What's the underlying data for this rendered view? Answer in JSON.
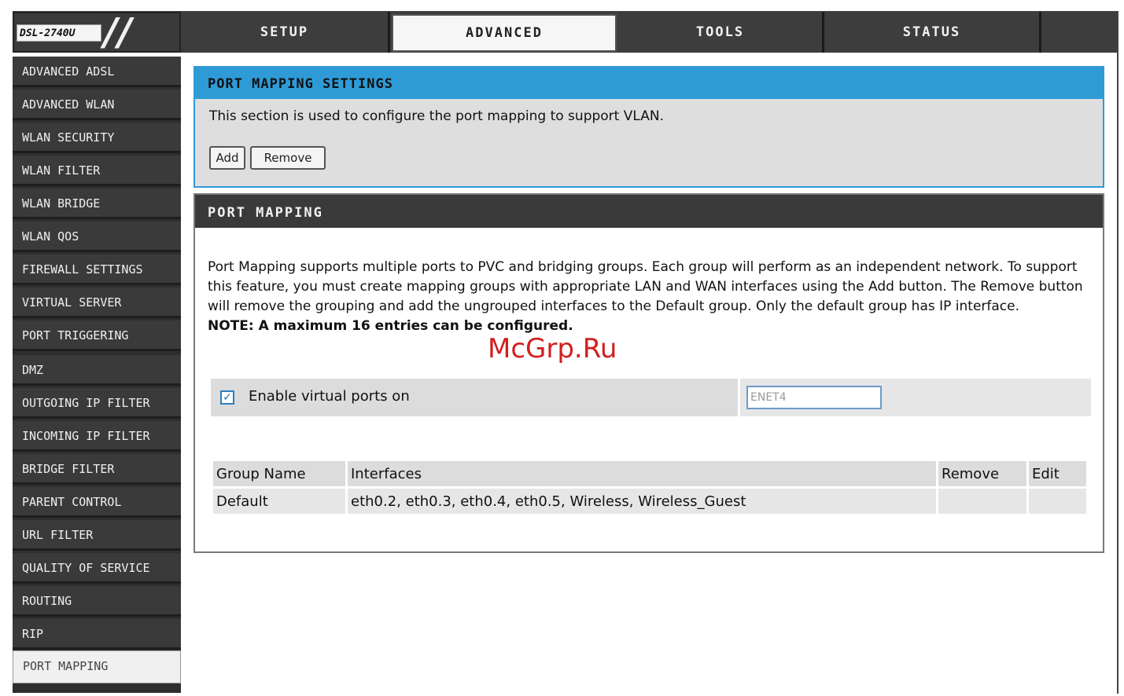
{
  "header": {
    "model": "DSL-2740U",
    "tabs": [
      "SETUP",
      "ADVANCED",
      "TOOLS",
      "STATUS"
    ],
    "active_tab": "ADVANCED"
  },
  "sidebar": {
    "items": [
      {
        "label": "ADVANCED ADSL"
      },
      {
        "label": "ADVANCED WLAN"
      },
      {
        "label": "WLAN SECURITY"
      },
      {
        "label": "WLAN FILTER"
      },
      {
        "label": "WLAN BRIDGE"
      },
      {
        "label": "WLAN QOS"
      },
      {
        "label": "FIREWALL SETTINGS"
      },
      {
        "label": "VIRTUAL SERVER"
      },
      {
        "label": "PORT TRIGGERING"
      },
      {
        "label": "DMZ"
      },
      {
        "label": "OUTGOING IP FILTER"
      },
      {
        "label": "INCOMING IP FILTER"
      },
      {
        "label": "BRIDGE FILTER"
      },
      {
        "label": "PARENT CONTROL"
      },
      {
        "label": "URL FILTER"
      },
      {
        "label": "QUALITY OF SERVICE"
      },
      {
        "label": "ROUTING"
      },
      {
        "label": "RIP"
      },
      {
        "label": "PORT MAPPING"
      }
    ],
    "active": "PORT MAPPING"
  },
  "settings": {
    "title": "PORT MAPPING SETTINGS",
    "description": "This section is used to configure the port mapping to support VLAN.",
    "add_label": "Add",
    "remove_label": "Remove"
  },
  "mapping": {
    "title": "PORT MAPPING",
    "paragraph": "Port Mapping supports multiple ports to PVC and bridging groups. Each group will perform as an independent network. To support this feature, you must create mapping groups with appropriate LAN and WAN interfaces using the Add button. The Remove button will remove the grouping and add the ungrouped interfaces to the Default group. Only the default group has IP interface.",
    "note": "NOTE: A maximum 16 entries can be configured.",
    "virtual_ports_label": "Enable virtual ports on",
    "virtual_ports_checked": true,
    "virtual_ports_value": "ENET4",
    "table": {
      "headers": [
        "Group Name",
        "Interfaces",
        "Remove",
        "Edit"
      ],
      "rows": [
        [
          "Default",
          "eth0.2, eth0.3, eth0.4, eth0.5, Wireless, Wireless_Guest",
          "",
          ""
        ]
      ]
    }
  },
  "watermark": "McGrp.Ru"
}
